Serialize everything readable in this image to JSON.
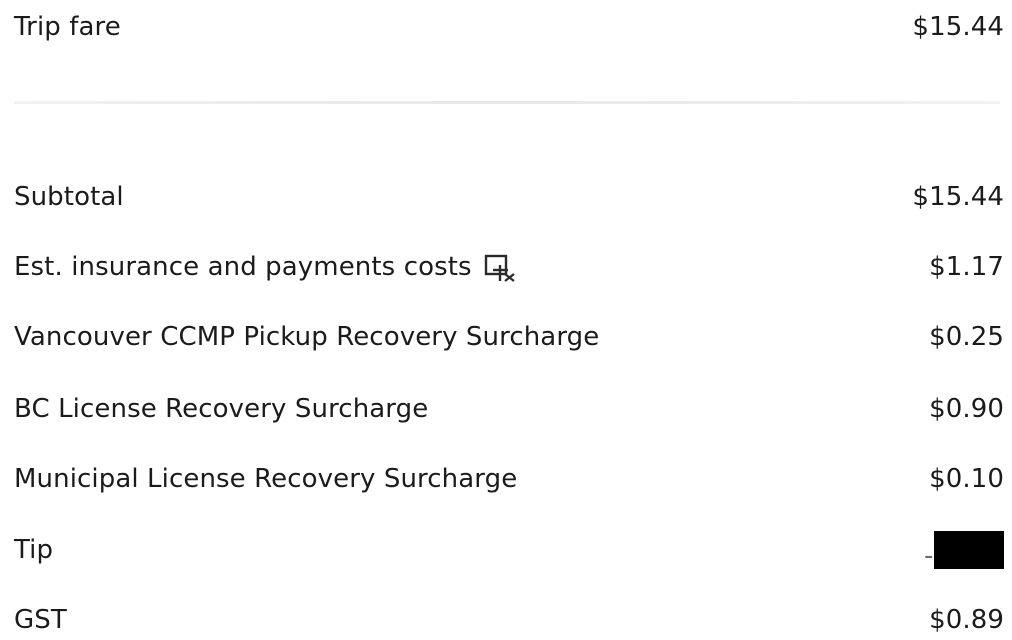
{
  "receipt": {
    "trip_fare": {
      "label": "Trip fare",
      "amount": "$15.44"
    },
    "subtotal": {
      "label": "Subtotal",
      "amount": "$15.44"
    },
    "insurance": {
      "label": "Est. insurance and payments costs",
      "amount": "$1.17",
      "icon": "info-icon"
    },
    "ccmp_surcharge": {
      "label": "Vancouver CCMP Pickup Recovery Surcharge",
      "amount": "$0.25"
    },
    "bc_license": {
      "label": "BC License Recovery Surcharge",
      "amount": "$0.90"
    },
    "municipal_license": {
      "label": "Municipal License Recovery Surcharge",
      "amount": "$0.10"
    },
    "tip": {
      "label": "Tip",
      "amount_prefix": "-$"
    },
    "gst": {
      "label": "GST",
      "amount": "$0.89"
    }
  }
}
